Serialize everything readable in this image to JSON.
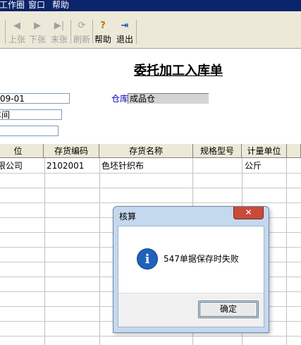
{
  "menu": {
    "items": [
      "工作圈",
      "窗口",
      "帮助"
    ]
  },
  "toolbar": {
    "buttons": [
      {
        "label": "",
        "icon": "partial-icon",
        "enabled": false
      },
      {
        "label": "上张",
        "icon": "arrow-left-icon",
        "enabled": false
      },
      {
        "label": "下张",
        "icon": "arrow-right-icon",
        "enabled": false
      },
      {
        "label": "末张",
        "icon": "arrow-last-icon",
        "enabled": false
      },
      {
        "label": "刷新",
        "icon": "refresh-icon",
        "enabled": false
      },
      {
        "label": "帮助",
        "icon": "help-icon",
        "enabled": true
      },
      {
        "label": "退出",
        "icon": "exit-icon",
        "enabled": true
      }
    ]
  },
  "form": {
    "title": "委托加工入库单",
    "date_value": "09-01",
    "second_value": "车间",
    "third_value": "",
    "warehouse_label": "仓库",
    "warehouse_value": "成品仓"
  },
  "grid": {
    "headers": [
      "位",
      "存货编码",
      "存货名称",
      "规格型号",
      "计量单位"
    ],
    "rows": [
      {
        "c0": "限公司",
        "c1": "2102001",
        "c2": "色坯针织布",
        "c3": "",
        "c4": "公斤"
      }
    ]
  },
  "dialog": {
    "title": "核算",
    "close_label": "✕",
    "message": "547单据保存时失败",
    "ok_label": "确定"
  },
  "colors": {
    "menubar": "#0a246a",
    "toolbar": "#ece9d8",
    "dialog_frame": "#c4d8ee",
    "close_button": "#c94a3a"
  }
}
